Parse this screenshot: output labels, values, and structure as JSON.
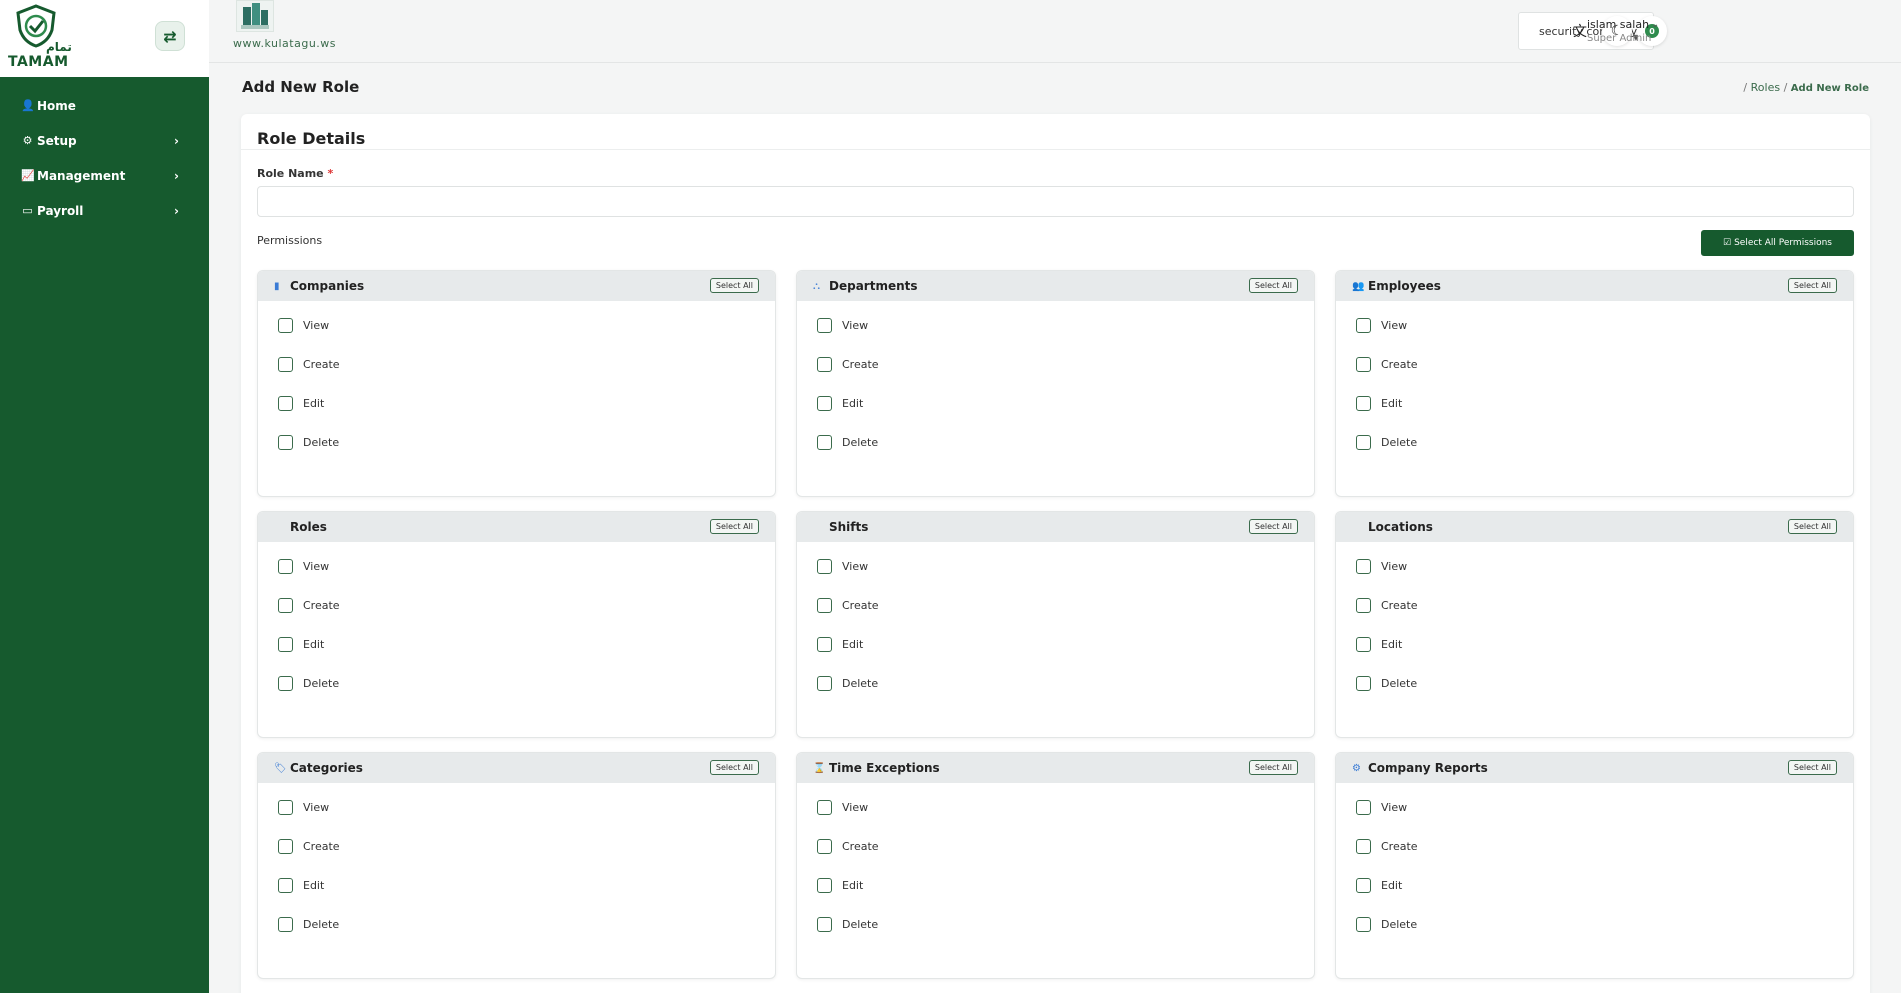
{
  "sidebar": {
    "brand_ar": "تمام",
    "brand_name": "TAMAM",
    "items": [
      {
        "label": "Home",
        "icon": "user-icon",
        "glyph": "👤"
      },
      {
        "label": "Setup",
        "icon": "cogs-icon",
        "glyph": "⚙"
      },
      {
        "label": "Management",
        "icon": "chart-line-icon",
        "glyph": "📈"
      },
      {
        "label": "Payroll",
        "icon": "credit-card-icon",
        "glyph": "▭"
      }
    ]
  },
  "topbar": {
    "site_url": "www.kulatagu.ws",
    "company_select": "security company",
    "notification_count": "0",
    "user_name": "islam salah",
    "user_role": "Super Admin"
  },
  "page": {
    "title": "Add New Role",
    "breadcrumb_sep": "/",
    "breadcrumb_link": "Roles",
    "breadcrumb_current": "Add New Role"
  },
  "form": {
    "card_title": "Role Details",
    "role_name_label": "Role Name",
    "required_mark": "*",
    "role_name_value": "",
    "permissions_label": "Permissions",
    "select_all_permissions": "Select All Permissions",
    "select_all": "Select All"
  },
  "permission_groups": [
    {
      "title": "Companies",
      "icon": "building-icon",
      "glyph": "▮",
      "items": [
        "View",
        "Create",
        "Edit",
        "Delete"
      ]
    },
    {
      "title": "Departments",
      "icon": "sitemap-icon",
      "glyph": "⛬",
      "items": [
        "View",
        "Create",
        "Edit",
        "Delete"
      ]
    },
    {
      "title": "Employees",
      "icon": "users-icon",
      "glyph": "👥",
      "items": [
        "View",
        "Create",
        "Edit",
        "Delete"
      ]
    },
    {
      "title": "Roles",
      "icon": "",
      "glyph": "",
      "items": [
        "View",
        "Create",
        "Edit",
        "Delete"
      ]
    },
    {
      "title": "Shifts",
      "icon": "",
      "glyph": "",
      "items": [
        "View",
        "Create",
        "Edit",
        "Delete"
      ]
    },
    {
      "title": "Locations",
      "icon": "",
      "glyph": "",
      "items": [
        "View",
        "Create",
        "Edit",
        "Delete"
      ]
    },
    {
      "title": "Categories",
      "icon": "tags-icon",
      "glyph": "🏷",
      "items": [
        "View",
        "Create",
        "Edit",
        "Delete"
      ]
    },
    {
      "title": "Time Exceptions",
      "icon": "hourglass-icon",
      "glyph": "⌛",
      "items": [
        "View",
        "Create",
        "Edit",
        "Delete"
      ]
    },
    {
      "title": "Company Reports",
      "icon": "cogs-icon",
      "glyph": "⚙",
      "items": [
        "View",
        "Create",
        "Edit",
        "Delete"
      ]
    }
  ],
  "colors": {
    "brand_green": "#165a2e",
    "accent_blue": "#3a7bd5"
  }
}
